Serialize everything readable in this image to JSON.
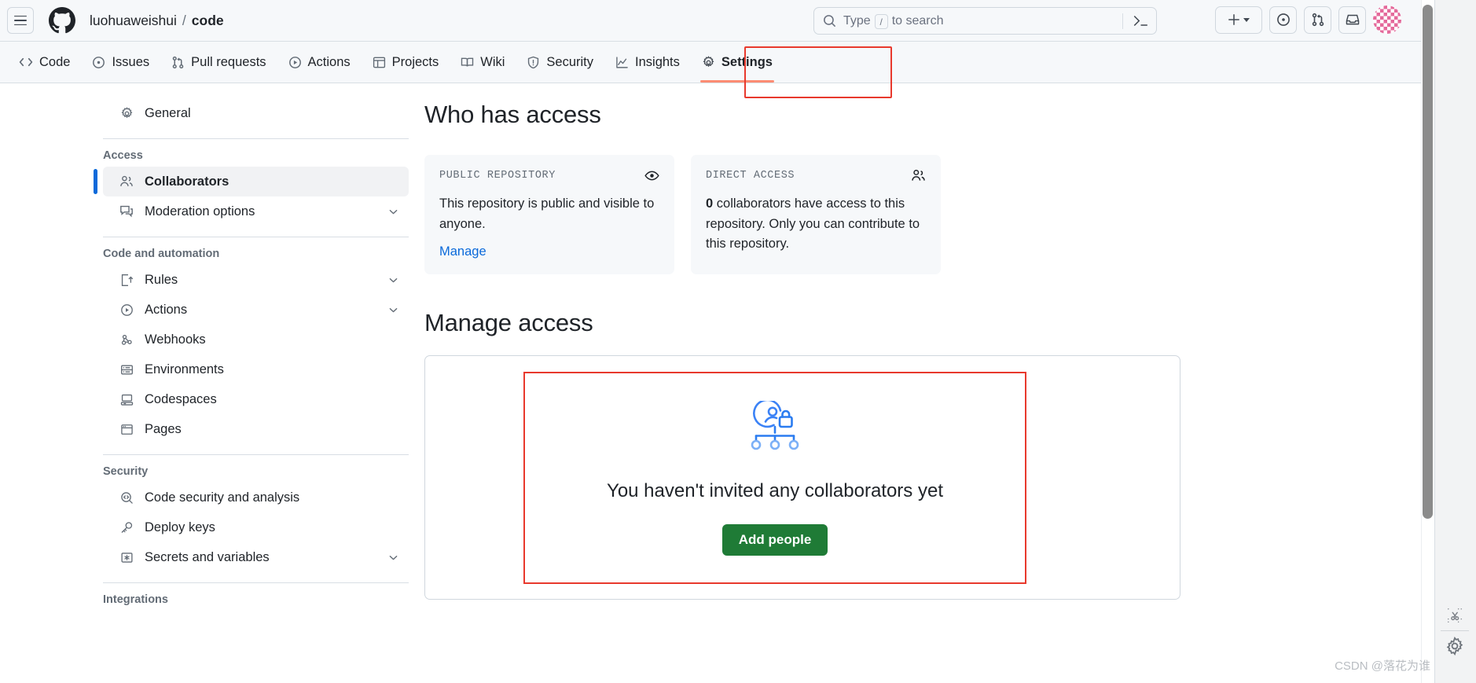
{
  "header": {
    "menu_icon": "hamburger-icon",
    "logo_icon": "github-logo-icon",
    "breadcrumb": {
      "owner": "luohuaweishui",
      "separator": "/",
      "repo": "code"
    },
    "search": {
      "icon": "search-icon",
      "placeholder_before": "Type",
      "key_hint": "/",
      "placeholder_after": "to search",
      "cli_icon": "command-palette-icon"
    },
    "actions": [
      {
        "name": "create-new-button",
        "icon": "plus-icon",
        "caret": "chevron-down-icon"
      },
      {
        "name": "issues-button",
        "icon": "issue-opened-icon"
      },
      {
        "name": "pull-requests-button",
        "icon": "git-pull-request-icon"
      },
      {
        "name": "inbox-button",
        "icon": "inbox-icon"
      },
      {
        "name": "avatar-button",
        "icon": "user-avatar"
      }
    ]
  },
  "repo_nav": {
    "tabs": [
      {
        "label": "Code",
        "icon": "code-icon",
        "active": false
      },
      {
        "label": "Issues",
        "icon": "issue-opened-icon",
        "active": false
      },
      {
        "label": "Pull requests",
        "icon": "git-pull-request-icon",
        "active": false
      },
      {
        "label": "Actions",
        "icon": "play-icon",
        "active": false
      },
      {
        "label": "Projects",
        "icon": "table-icon",
        "active": false
      },
      {
        "label": "Wiki",
        "icon": "book-icon",
        "active": false
      },
      {
        "label": "Security",
        "icon": "shield-icon",
        "active": false
      },
      {
        "label": "Insights",
        "icon": "graph-icon",
        "active": false
      },
      {
        "label": "Settings",
        "icon": "gear-icon",
        "active": true
      }
    ]
  },
  "sidebar": {
    "top_item": {
      "label": "General",
      "icon": "gear-icon"
    },
    "sections": [
      {
        "heading": "Access",
        "items": [
          {
            "label": "Collaborators",
            "icon": "people-icon",
            "selected": true,
            "expandable": false
          },
          {
            "label": "Moderation options",
            "icon": "comment-discussion-icon",
            "selected": false,
            "expandable": true
          }
        ]
      },
      {
        "heading": "Code and automation",
        "items": [
          {
            "label": "Rules",
            "icon": "rules-icon",
            "selected": false,
            "expandable": true
          },
          {
            "label": "Actions",
            "icon": "play-icon",
            "selected": false,
            "expandable": true
          },
          {
            "label": "Webhooks",
            "icon": "webhook-icon",
            "selected": false,
            "expandable": false
          },
          {
            "label": "Environments",
            "icon": "server-icon",
            "selected": false,
            "expandable": false
          },
          {
            "label": "Codespaces",
            "icon": "codespaces-icon",
            "selected": false,
            "expandable": false
          },
          {
            "label": "Pages",
            "icon": "browser-icon",
            "selected": false,
            "expandable": false
          }
        ]
      },
      {
        "heading": "Security",
        "items": [
          {
            "label": "Code security and analysis",
            "icon": "code-scan-icon",
            "selected": false,
            "expandable": false
          },
          {
            "label": "Deploy keys",
            "icon": "key-icon",
            "selected": false,
            "expandable": false
          },
          {
            "label": "Secrets and variables",
            "icon": "asterisk-key-icon",
            "selected": false,
            "expandable": true
          }
        ]
      },
      {
        "heading": "Integrations",
        "items": []
      }
    ]
  },
  "main": {
    "who_has_access_title": "Who has access",
    "cards": [
      {
        "label": "PUBLIC REPOSITORY",
        "icon": "eye-icon",
        "body": "This repository is public and visible to anyone.",
        "link": "Manage"
      },
      {
        "label": "DIRECT ACCESS",
        "icon": "people-icon",
        "body_bold": "0",
        "body": "collaborators have access to this repository. Only you can contribute to this repository."
      }
    ],
    "manage_access_title": "Manage access",
    "empty_state": {
      "illustration": "locked-org-chart-illustration",
      "title": "You haven't invited any collaborators yet",
      "button_label": "Add people"
    }
  },
  "chrome": {
    "watermark": "CSDN @落花为谁",
    "rail": [
      {
        "name": "snip-tool-icon"
      },
      {
        "name": "gear-icon"
      }
    ]
  },
  "colors": {
    "accent_blue": "#0969da",
    "active_tab_underline": "#fd8c73",
    "annotation_red": "#e8392d",
    "button_green": "#1f7b36",
    "illustration_blue": "#3b82f6"
  }
}
